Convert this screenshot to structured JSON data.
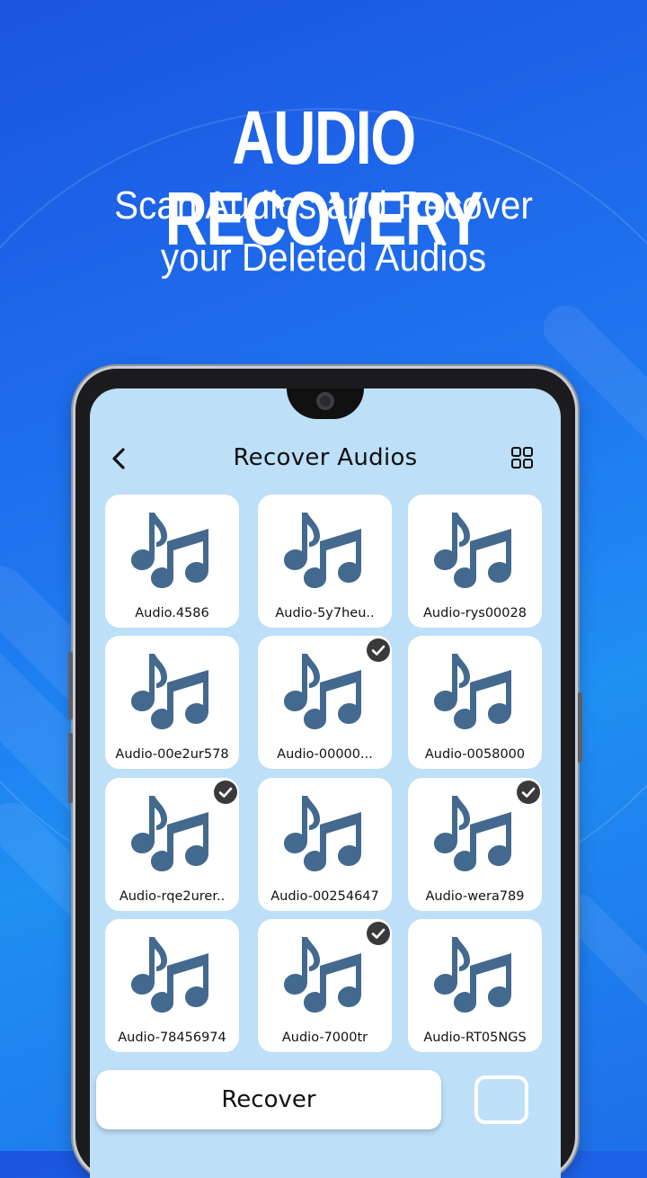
{
  "promo": {
    "headline": "AUDIO RECOVERY",
    "subline_1": "Scan Audios and Recover",
    "subline_2": "your Deleted Audios"
  },
  "app": {
    "title": "Recover Audios",
    "back_icon": "chevron-left-icon",
    "view_toggle_icon": "grid-view-icon"
  },
  "audio_items": [
    {
      "name": "Audio.4586",
      "selected": false
    },
    {
      "name": "Audio-5y7heu..",
      "selected": false
    },
    {
      "name": "Audio-rys00028",
      "selected": false
    },
    {
      "name": "Audio-00e2ur578",
      "selected": false
    },
    {
      "name": "Audio-00000...",
      "selected": true
    },
    {
      "name": "Audio-0058000",
      "selected": false
    },
    {
      "name": "Audio-rqe2urer..",
      "selected": true
    },
    {
      "name": "Audio-00254647",
      "selected": false
    },
    {
      "name": "Audio-wera789",
      "selected": true
    },
    {
      "name": "Audio-78456974",
      "selected": false
    },
    {
      "name": "Audio-7000tr",
      "selected": true
    },
    {
      "name": "Audio-RT05NGS",
      "selected": false
    }
  ],
  "footer": {
    "recover_label": "Recover",
    "select_all_checked": false
  },
  "colors": {
    "icon": "#44698e",
    "screen_bg": "#bddff8",
    "check_badge": "#3a3a3c"
  }
}
